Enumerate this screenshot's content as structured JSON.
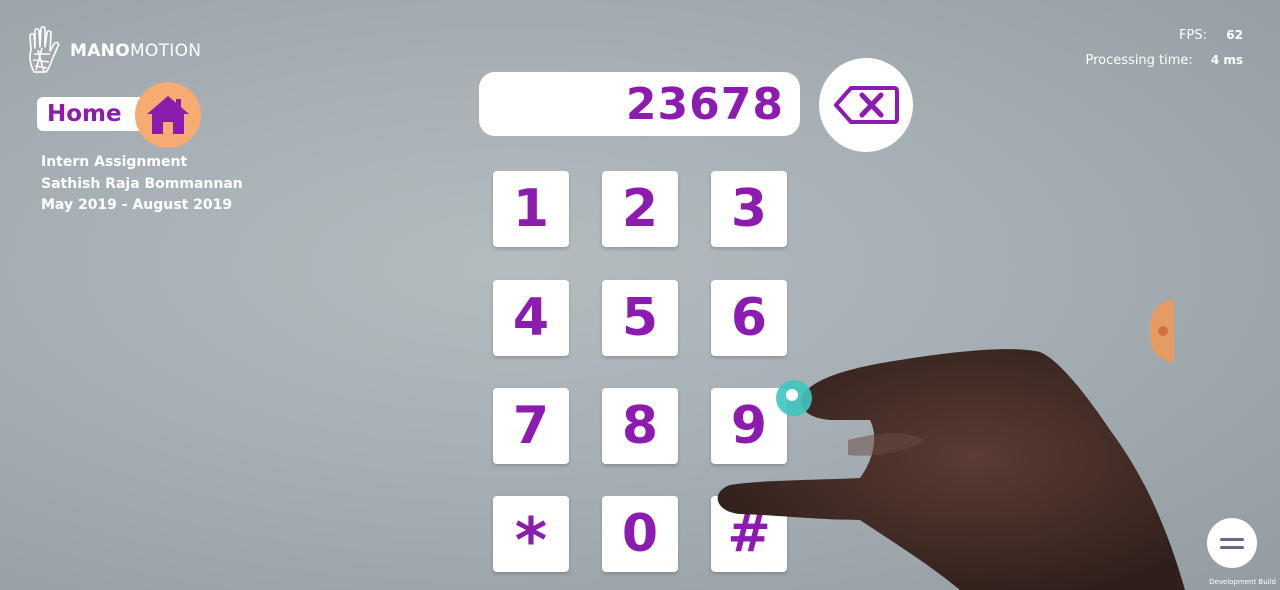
{
  "brand": {
    "name_bold": "MANO",
    "name_light": "MOTION"
  },
  "home": {
    "label": "Home"
  },
  "info_lines": [
    "Intern Assignment",
    "Sathish Raja Bommannan",
    "May 2019 - August 2019"
  ],
  "stats": {
    "fps_label": "FPS:",
    "fps_value": "62",
    "processing_label": "Processing time:",
    "processing_value": "4 ms"
  },
  "display": {
    "value": "23678"
  },
  "keypad": [
    "1",
    "2",
    "3",
    "4",
    "5",
    "6",
    "7",
    "8",
    "9",
    "*",
    "0",
    "#"
  ],
  "footer": {
    "dev_build": "Development Build"
  },
  "colors": {
    "accent": "#8c1bb0",
    "home_circle": "#f6ab72",
    "cursor": "#40c5be"
  },
  "icons": {
    "logo": "hand-logo-icon",
    "home": "home-icon",
    "backspace": "backspace-icon",
    "menu": "hamburger-menu-icon"
  }
}
